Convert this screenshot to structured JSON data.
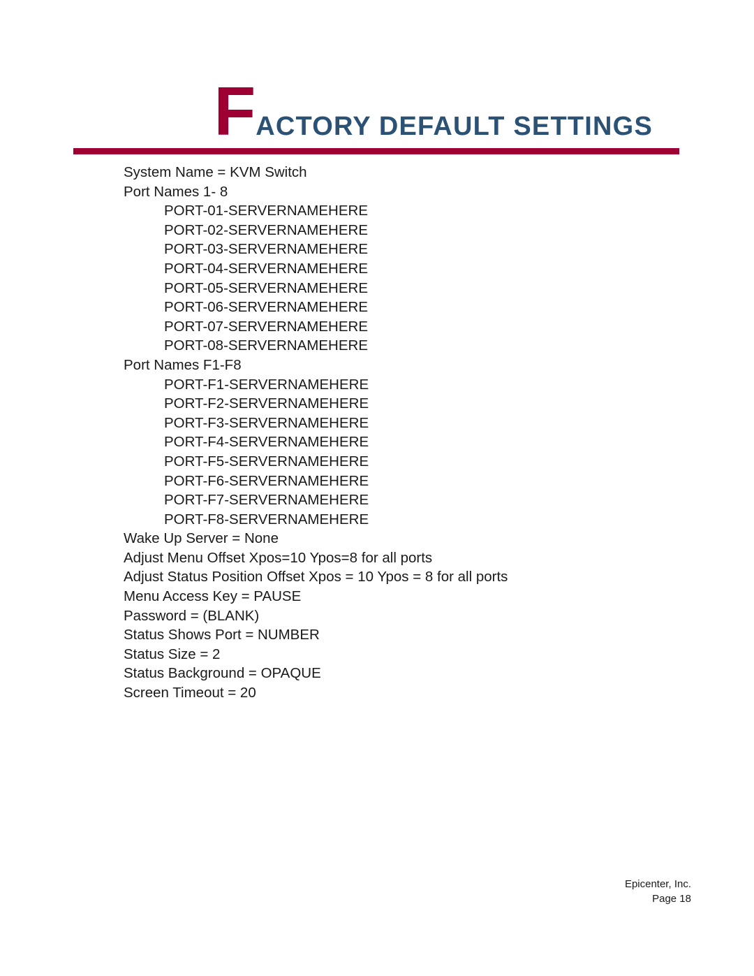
{
  "header": {
    "drop_cap": "F",
    "title_rest": "ACTORY DEFAULT SETTINGS",
    "full_title": "FACTORY DEFAULT SETTINGS",
    "accent_color": "#9e0033",
    "title_color": "#2b5275"
  },
  "body": {
    "lines": [
      {
        "text": "System Name = KVM Switch",
        "indent": false
      },
      {
        "text": "Port Names 1- 8",
        "indent": false
      },
      {
        "text": "PORT-01-SERVERNAMEHERE",
        "indent": true
      },
      {
        "text": "PORT-02-SERVERNAMEHERE",
        "indent": true
      },
      {
        "text": "PORT-03-SERVERNAMEHERE",
        "indent": true
      },
      {
        "text": "PORT-04-SERVERNAMEHERE",
        "indent": true
      },
      {
        "text": "PORT-05-SERVERNAMEHERE",
        "indent": true
      },
      {
        "text": "PORT-06-SERVERNAMEHERE",
        "indent": true
      },
      {
        "text": "PORT-07-SERVERNAMEHERE",
        "indent": true
      },
      {
        "text": "PORT-08-SERVERNAMEHERE",
        "indent": true
      },
      {
        "text": "Port Names F1-F8",
        "indent": false
      },
      {
        "text": "PORT-F1-SERVERNAMEHERE",
        "indent": true
      },
      {
        "text": "PORT-F2-SERVERNAMEHERE",
        "indent": true
      },
      {
        "text": "PORT-F3-SERVERNAMEHERE",
        "indent": true
      },
      {
        "text": "PORT-F4-SERVERNAMEHERE",
        "indent": true
      },
      {
        "text": "PORT-F5-SERVERNAMEHERE",
        "indent": true
      },
      {
        "text": "PORT-F6-SERVERNAMEHERE",
        "indent": true
      },
      {
        "text": "PORT-F7-SERVERNAMEHERE",
        "indent": true
      },
      {
        "text": "PORT-F8-SERVERNAMEHERE",
        "indent": true
      },
      {
        "text": "Wake Up Server = None",
        "indent": false
      },
      {
        "text": "Adjust Menu Offset Xpos=10 Ypos=8 for all ports",
        "indent": false
      },
      {
        "text": "Adjust Status Position Offset Xpos = 10 Ypos = 8 for all ports",
        "indent": false
      },
      {
        "text": "Menu Access Key = PAUSE",
        "indent": false
      },
      {
        "text": "Password = (BLANK)",
        "indent": false
      },
      {
        "text": "Status Shows Port = NUMBER",
        "indent": false
      },
      {
        "text": "Status Size = 2",
        "indent": false
      },
      {
        "text": "Status Background = OPAQUE",
        "indent": false
      },
      {
        "text": "Screen Timeout = 20",
        "indent": false
      }
    ]
  },
  "footer": {
    "company": "Epicenter, Inc.",
    "page": "Page 18"
  }
}
